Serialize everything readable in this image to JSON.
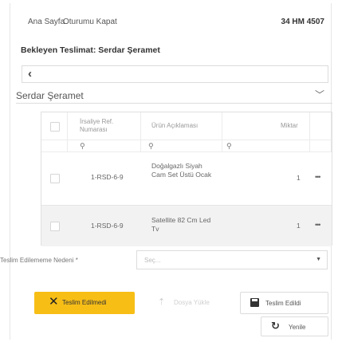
{
  "nav": {
    "home": "Ana Sayfa",
    "logout": "Oturumu Kapat",
    "plate": "34 HM 4507"
  },
  "page": {
    "title": "Bekleyen Teslimat: Serdar Şeramet",
    "back_icon": "chevron-left-icon"
  },
  "group": {
    "title": "Serdar Şeramet",
    "toggle_icon": "chevron-down-icon"
  },
  "table": {
    "columns": [
      "İrsaliye Ref. Numarası",
      "Ürün Açıklaması",
      "Miktar"
    ],
    "filter_icon": "search-icon",
    "rows": [
      {
        "ref": "1-RSD-6-9",
        "description": "Doğalgazlı Siyah Cam Set Üstü Ocak",
        "qty": "1",
        "menu": "•••"
      },
      {
        "ref": "1-RSD-6-9",
        "description": "Satellite 82 Cm Led Tv",
        "qty": "1",
        "menu": "•••"
      }
    ]
  },
  "reason": {
    "label": "Teslim Edilememe Nedeni *",
    "placeholder": "Seç..."
  },
  "buttons": {
    "not_delivered": "Teslim Edilmedi",
    "upload": "Dosya Yükle",
    "delivered": "Teslim Edildi",
    "refresh": "Yenile"
  },
  "colors": {
    "accent": "#f7be16",
    "row_alt": "#f2f2f2"
  }
}
